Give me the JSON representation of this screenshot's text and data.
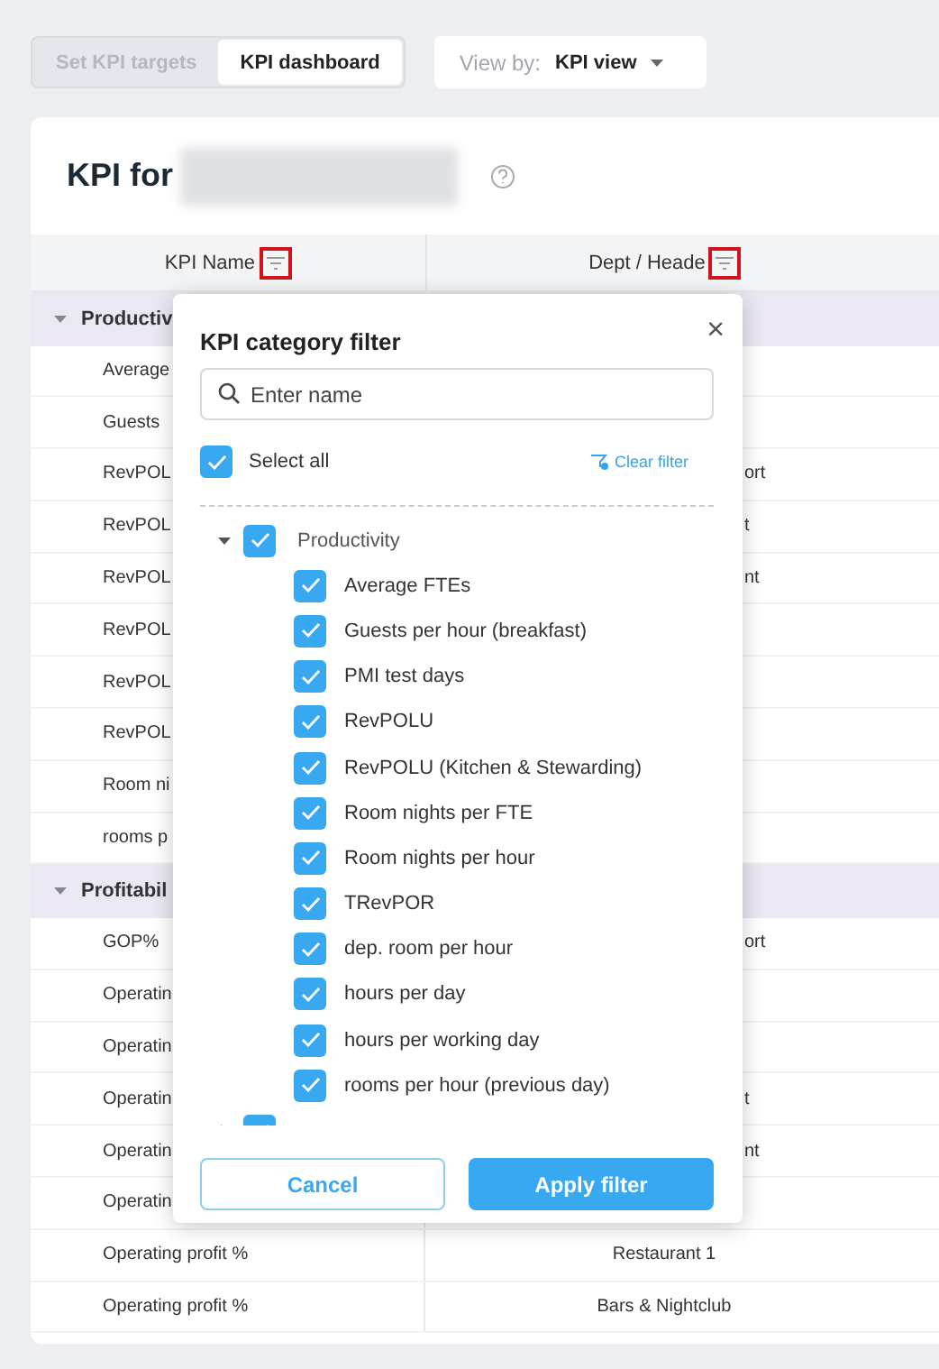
{
  "tabs": [
    {
      "label": "Set KPI targets",
      "selected": false
    },
    {
      "label": "KPI dashboard",
      "selected": true
    }
  ],
  "view_by": {
    "label": "View by:",
    "value": "KPI view"
  },
  "card": {
    "title": "KPI for"
  },
  "table": {
    "columns": [
      {
        "label": "KPI Name",
        "highlighted": true
      },
      {
        "label": "Dept / Heade",
        "highlighted": true
      }
    ],
    "groups": [
      {
        "label": "Productiv",
        "expanded": true,
        "rows": [
          {
            "name": "Average"
          },
          {
            "name": "Guests"
          },
          {
            "name": "RevPOL",
            "dept": "ort",
            "kind": "cut"
          },
          {
            "name": "RevPOL",
            "dept": "t",
            "kind": "cut"
          },
          {
            "name": "RevPOL",
            "dept": "nt",
            "kind": "cut"
          },
          {
            "name": "RevPOL"
          },
          {
            "name": "RevPOL"
          },
          {
            "name": "RevPOL"
          },
          {
            "name": "Room ni"
          },
          {
            "name": "rooms p"
          }
        ]
      },
      {
        "label": "Profitabil",
        "expanded": true,
        "rows": [
          {
            "name": "GOP%",
            "dept": "ort",
            "kind": "cut"
          },
          {
            "name": "Operatin"
          },
          {
            "name": "Operatin"
          },
          {
            "name": "Operatin",
            "dept": "t",
            "kind": "cut"
          },
          {
            "name": "Operatin",
            "dept": "nt",
            "kind": "cut"
          },
          {
            "name": "Operatin"
          },
          {
            "name": "Operating profit %",
            "dept": "Restaurant 1",
            "kind": "full"
          },
          {
            "name": "Operating profit %",
            "dept": "Bars & Nightclub",
            "kind": "full"
          }
        ]
      }
    ]
  },
  "filter_popup": {
    "title": "KPI category filter",
    "close": "×",
    "search": {
      "placeholder": "Enter name"
    },
    "select_all": {
      "label": "Select all",
      "checked": true
    },
    "clear_label": "Clear filter",
    "tree": [
      {
        "label": "Productivity",
        "checked": true,
        "expanded": true,
        "children": [
          {
            "label": "Average FTEs",
            "checked": true
          },
          {
            "label": "Guests per hour (breakfast)",
            "checked": true
          },
          {
            "label": "PMI test days",
            "checked": true
          },
          {
            "label": "RevPOLU",
            "checked": true
          },
          {
            "label": "RevPOLU (Kitchen & Stewarding)",
            "checked": true
          },
          {
            "label": "Room nights per FTE",
            "checked": true
          },
          {
            "label": "Room nights per hour",
            "checked": true
          },
          {
            "label": "TRevPOR",
            "checked": true
          },
          {
            "label": "dep. room per hour",
            "checked": true
          },
          {
            "label": "hours per day",
            "checked": true
          },
          {
            "label": "hours per working day",
            "checked": true
          },
          {
            "label": "rooms per hour (previous day)",
            "checked": true
          }
        ]
      },
      {
        "checked": true
      }
    ],
    "buttons": [
      {
        "label": "Cancel",
        "kind": "secondary"
      },
      {
        "label": "Apply filter",
        "kind": "primary"
      }
    ]
  }
}
